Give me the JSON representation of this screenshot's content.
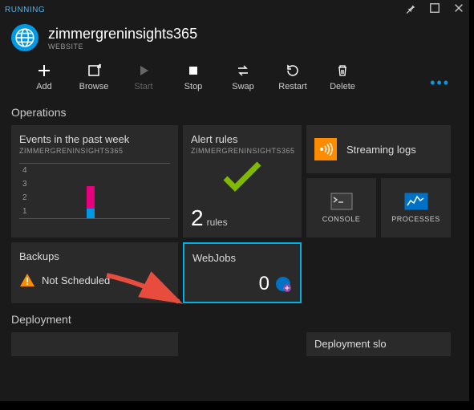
{
  "status": "RUNNING",
  "title": "zimmergreninsights365",
  "subtitle": "WEBSITE",
  "toolbar": {
    "add": "Add",
    "browse": "Browse",
    "start": "Start",
    "stop": "Stop",
    "swap": "Swap",
    "restart": "Restart",
    "delete": "Delete"
  },
  "sections": {
    "operations": "Operations",
    "deployment": "Deployment"
  },
  "tiles": {
    "events": {
      "title": "Events in the past week",
      "sub": "ZIMMERGRENINSIGHTS365"
    },
    "alerts": {
      "title": "Alert rules",
      "sub": "ZIMMERGRENINSIGHTS365",
      "count": "2",
      "unit": "rules"
    },
    "stream": {
      "label": "Streaming logs"
    },
    "console": {
      "label": "CONSOLE"
    },
    "processes": {
      "label": "PROCESSES"
    },
    "backups": {
      "title": "Backups",
      "status": "Not Scheduled"
    },
    "webjobs": {
      "title": "WebJobs",
      "count": "0"
    },
    "deployslot": {
      "label": "Deployment slo"
    }
  },
  "chart_data": {
    "type": "bar",
    "ylabels": [
      "4",
      "3",
      "2",
      "1"
    ],
    "series": [
      {
        "name": "pink",
        "value": 3,
        "color": "#e6007e"
      },
      {
        "name": "blue",
        "value": 1,
        "color": "#0099e5"
      }
    ]
  }
}
